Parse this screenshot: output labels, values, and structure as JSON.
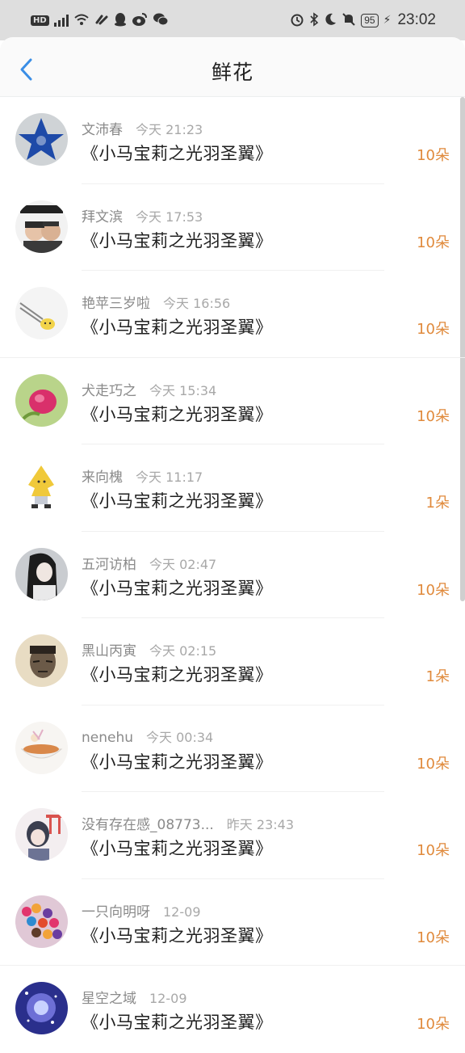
{
  "status_bar": {
    "left_icons": [
      "hd-icon",
      "5g-signal-icon",
      "6g-wifi-icon",
      "link-icon",
      "qq-icon",
      "weibo-icon",
      "wechat-icon"
    ],
    "right_icons": [
      "alarm-icon",
      "bluetooth-icon",
      "moon-icon",
      "mute-icon"
    ],
    "battery": "95",
    "time": "23:02"
  },
  "header": {
    "title": "鲜花"
  },
  "flowers": [
    {
      "name": "文沛春",
      "time": "今天 21:23",
      "book": "《小马宝莉之光羽圣翼》",
      "count": "10朵"
    },
    {
      "name": "拜文滨",
      "time": "今天 17:53",
      "book": "《小马宝莉之光羽圣翼》",
      "count": "10朵"
    },
    {
      "name": "艳苹三岁啦",
      "time": "今天 16:56",
      "book": "《小马宝莉之光羽圣翼》",
      "count": "10朵"
    },
    {
      "name": "犬走巧之",
      "time": "今天 15:34",
      "book": "《小马宝莉之光羽圣翼》",
      "count": "10朵"
    },
    {
      "name": "来向槐",
      "time": "今天 11:17",
      "book": "《小马宝莉之光羽圣翼》",
      "count": "1朵"
    },
    {
      "name": "五河访柏",
      "time": "今天 02:47",
      "book": "《小马宝莉之光羽圣翼》",
      "count": "10朵"
    },
    {
      "name": "黑山丙寅",
      "time": "今天 02:15",
      "book": "《小马宝莉之光羽圣翼》",
      "count": "1朵"
    },
    {
      "name": "nenehu",
      "time": "今天 00:34",
      "book": "《小马宝莉之光羽圣翼》",
      "count": "10朵"
    },
    {
      "name": "没有存在感_08773...",
      "time": "昨天 23:43",
      "book": "《小马宝莉之光羽圣翼》",
      "count": "10朵"
    },
    {
      "name": "一只向明呀",
      "time": "12-09",
      "book": "《小马宝莉之光羽圣翼》",
      "count": "10朵"
    },
    {
      "name": "星空之域",
      "time": "12-09",
      "book": "《小马宝莉之光羽圣翼》",
      "count": "10朵"
    }
  ],
  "colors": {
    "accent": "#e08a3c",
    "back_arrow": "#3a8ee6",
    "statusbar_bg": "#dedede"
  }
}
